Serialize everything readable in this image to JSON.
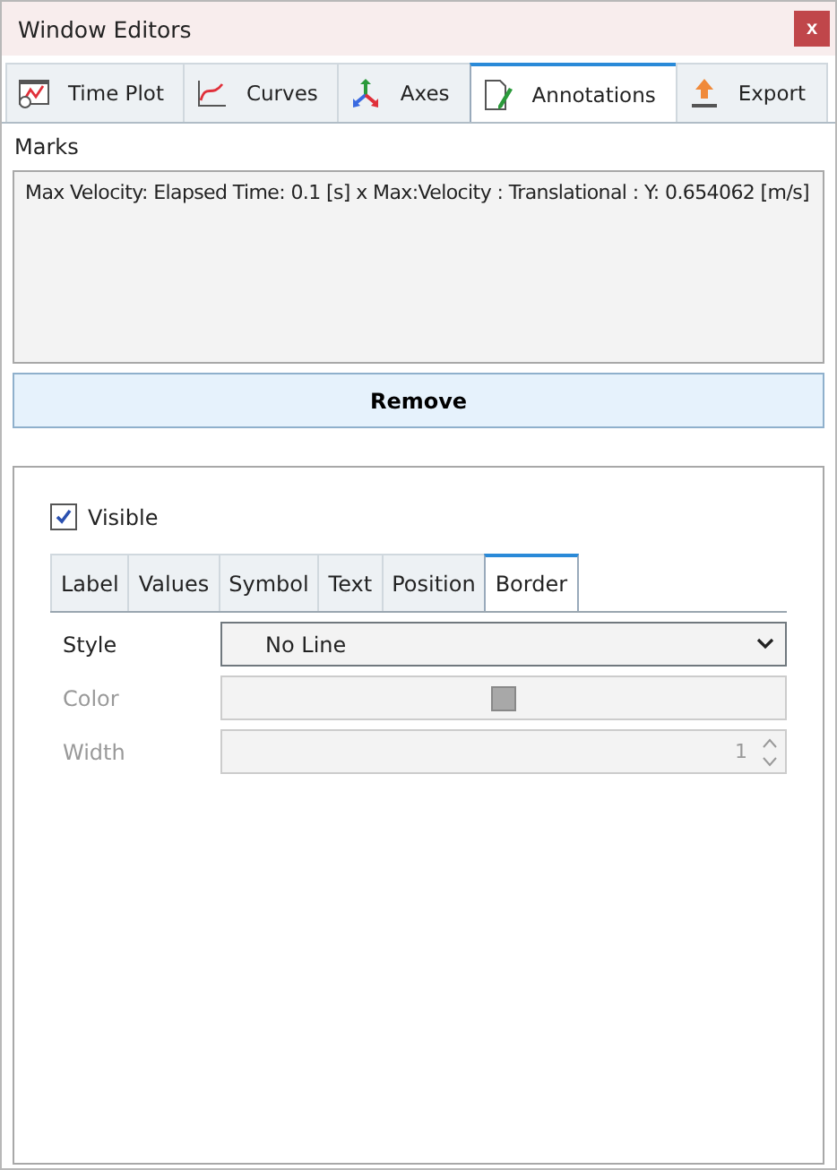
{
  "window": {
    "title": "Window Editors",
    "close": "x"
  },
  "tabs": [
    {
      "label": "Time Plot",
      "kind": "timeplot",
      "selected": false
    },
    {
      "label": "Curves",
      "kind": "curves",
      "selected": false
    },
    {
      "label": "Axes",
      "kind": "axes",
      "selected": false
    },
    {
      "label": "Annotations",
      "kind": "annotations",
      "selected": true
    },
    {
      "label": "Export",
      "kind": "export",
      "selected": false
    }
  ],
  "marks": {
    "label": "Marks",
    "items": [
      "Max Velocity: Elapsed Time: 0.1 [s] x Max:Velocity : Translational : Y: 0.654062 [m/s]"
    ]
  },
  "remove_button": "Remove",
  "visible": {
    "label": "Visible",
    "checked": true
  },
  "subtabs": [
    {
      "label": "Label",
      "selected": false
    },
    {
      "label": "Values",
      "selected": false
    },
    {
      "label": "Symbol",
      "selected": false
    },
    {
      "label": "Text",
      "selected": false
    },
    {
      "label": "Position",
      "selected": false
    },
    {
      "label": "Border",
      "selected": true
    }
  ],
  "fields": [
    {
      "label": "Style",
      "kind": "select",
      "value": "No Line",
      "disabled": false
    },
    {
      "label": "Color",
      "kind": "color",
      "disabled": true
    },
    {
      "label": "Width",
      "kind": "spin",
      "value": "1",
      "disabled": true
    }
  ]
}
